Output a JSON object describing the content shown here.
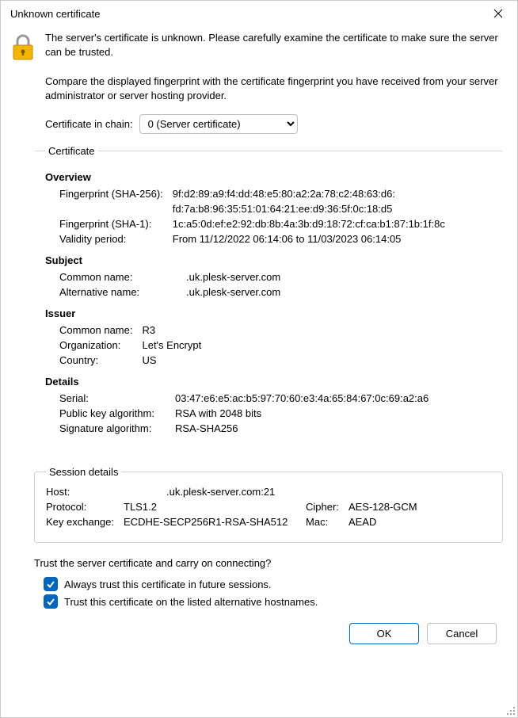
{
  "title": "Unknown certificate",
  "lead": "The server's certificate is unknown. Please carefully examine the certificate to make sure the server can be trusted.",
  "compare": "Compare the displayed fingerprint with the certificate fingerprint you have received from your server administrator or server hosting provider.",
  "chain_label": "Certificate in chain:",
  "chain_selected": "0 (Server certificate)",
  "cert_legend": "Certificate",
  "overview": {
    "heading": "Overview",
    "fp256_label": "Fingerprint (SHA-256):",
    "fp256_l1": "9f:d2:89:a9:f4:dd:48:e5:80:a2:2a:78:c2:48:63:d6:",
    "fp256_l2": "fd:7a:b8:96:35:51:01:64:21:ee:d9:36:5f:0c:18:d5",
    "fp1_label": "Fingerprint (SHA-1):",
    "fp1": "1c:a5:0d:ef:e2:92:db:8b:4a:3b:d9:18:72:cf:ca:b1:87:1b:1f:8c",
    "validity_label": "Validity period:",
    "validity": "From 11/12/2022 06:14:06 to 11/03/2023 06:14:05"
  },
  "subject": {
    "heading": "Subject",
    "cn_label": "Common name:",
    "cn": ".uk.plesk-server.com",
    "an_label": "Alternative name:",
    "an": ".uk.plesk-server.com"
  },
  "issuer": {
    "heading": "Issuer",
    "cn_label": "Common name:",
    "cn": "R3",
    "org_label": "Organization:",
    "org": "Let's Encrypt",
    "country_label": "Country:",
    "country": "US"
  },
  "details": {
    "heading": "Details",
    "serial_label": "Serial:",
    "serial": "03:47:e6:e5:ac:b5:97:70:60:e3:4a:65:84:67:0c:69:a2:a6",
    "pk_label": "Public key algorithm:",
    "pk": "RSA with 2048 bits",
    "sig_label": "Signature algorithm:",
    "sig": "RSA-SHA256"
  },
  "session": {
    "legend": "Session details",
    "host_label": "Host:",
    "host": ".uk.plesk-server.com:21",
    "proto_label": "Protocol:",
    "proto": "TLS1.2",
    "cipher_label": "Cipher:",
    "cipher": "AES-128-GCM",
    "kex_label": "Key exchange:",
    "kex": "ECDHE-SECP256R1-RSA-SHA512",
    "mac_label": "Mac:",
    "mac": "AEAD"
  },
  "trust_question": "Trust the server certificate and carry on connecting?",
  "cb_always": "Always trust this certificate in future sessions.",
  "cb_altnames": "Trust this certificate on the listed alternative hostnames.",
  "ok": "OK",
  "cancel": "Cancel"
}
